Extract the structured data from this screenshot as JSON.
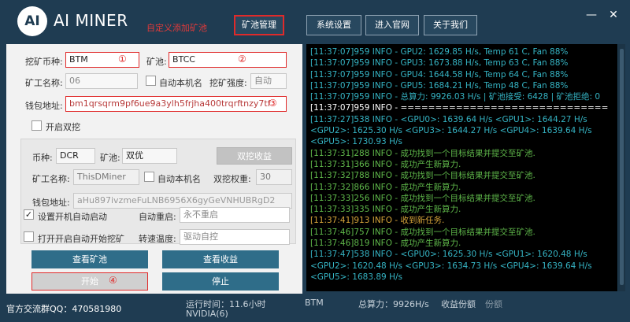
{
  "app": {
    "logo_text": "AI",
    "title": "AI MINER"
  },
  "annotations": {
    "custom_pool": "自定义添加矿池",
    "coin": "①",
    "pool": "②",
    "wallet": "③",
    "start": "④"
  },
  "nav": {
    "pool_manage": "矿池管理",
    "settings": "系统设置",
    "website": "进入官网",
    "about": "关于我们"
  },
  "window": {
    "minimize": "—",
    "close": "✕"
  },
  "form": {
    "coin_label": "挖矿币种:",
    "coin_value": "BTM",
    "pool_label": "矿池:",
    "pool_value": "BTCC",
    "worker_label": "矿工名称:",
    "worker_value": "06",
    "auto_name_label": "自动本机名",
    "intensity_label": "挖矿强度:",
    "intensity_value": "自动",
    "wallet_label": "钱包地址:",
    "wallet_value": "bm1qrsqrm9pf6ue9a3ylh5frjha400trqrftnzy7tf"
  },
  "dual": {
    "enable_label": "开启双挖",
    "coin_label": "币种:",
    "coin_value": "DCR",
    "pool_label": "矿池:",
    "pool_value": "双优",
    "profit_button": "双挖收益",
    "worker_label": "矿工名称:",
    "worker_placeholder": "ThisDMiner",
    "auto_name_label": "自动本机名",
    "weight_label": "双挖权重:",
    "weight_value": "30",
    "wallet_label": "钱包地址:",
    "wallet_placeholder": "aHu897ivzmeFuLNB6956X6gyGeVNHUBRgD2"
  },
  "startup": {
    "autostart_label": "设置开机自动启动",
    "autostart_checked": true,
    "restart_label": "自动重启:",
    "restart_value": "永不重启",
    "open_mine_label": "打开开启自动开始挖矿",
    "temp_label": "转速温度:",
    "temp_value": "驱动自控"
  },
  "actions": {
    "view_pool": "查看矿池",
    "view_profit": "查看收益",
    "start": "开始",
    "stop": "停止"
  },
  "log": [
    {
      "text": "[11:37:07]959 INFO - GPU2: 1629.85 H/s, Temp 61 C, Fan 88%",
      "color": "#35b4c4"
    },
    {
      "text": "[11:37:07]959 INFO - GPU3: 1673.88 H/s, Temp 63 C, Fan 88%",
      "color": "#35b4c4"
    },
    {
      "text": "[11:37:07]959 INFO - GPU4: 1644.58 H/s, Temp 64 C, Fan 88%",
      "color": "#35b4c4"
    },
    {
      "text": "[11:37:07]959 INFO - GPU5: 1684.21 H/s, Temp 48 C, Fan 88%",
      "color": "#35b4c4"
    },
    {
      "text": "[11:37:07]959 INFO - 总算力: 9926.03 H/s | 矿池接受: 6428 | 矿池拒绝: 0",
      "color": "#35b4c4"
    },
    {
      "text": "[11:37:07]959 INFO - ==============================",
      "color": "#ffffff"
    },
    {
      "text": "[11:37:27]538 INFO - <GPU0>: 1639.64 H/s   <GPU1>: 1644.27 H/s",
      "color": "#35b4c4"
    },
    {
      "text": "<GPU2>: 1625.30 H/s   <GPU3>: 1644.27 H/s   <GPU4>: 1639.64 H/s",
      "color": "#35b4c4"
    },
    {
      "text": "<GPU5>: 1730.93 H/s",
      "color": "#35b4c4"
    },
    {
      "text": "[11:37:31]288 INFO - 成功找到一个目标结果并提交至矿池.",
      "color": "#5fb84a"
    },
    {
      "text": "[11:37:31]366 INFO - 成功产生新算力.",
      "color": "#5fb84a"
    },
    {
      "text": "[11:37:32]788 INFO - 成功找到一个目标结果并提交至矿池.",
      "color": "#5fb84a"
    },
    {
      "text": "[11:37:32]866 INFO - 成功产生新算力.",
      "color": "#5fb84a"
    },
    {
      "text": "[11:37:33]256 INFO - 成功找到一个目标结果并提交至矿池.",
      "color": "#5fb84a"
    },
    {
      "text": "[11:37:33]335 INFO - 成功产生新算力.",
      "color": "#5fb84a"
    },
    {
      "text": "[11:37:41]913 INFO - 收到新任务.",
      "color": "#d6a43a"
    },
    {
      "text": "[11:37:46]757 INFO - 成功找到一个目标结果并提交至矿池.",
      "color": "#5fb84a"
    },
    {
      "text": "[11:37:46]819 INFO - 成功产生新算力.",
      "color": "#5fb84a"
    },
    {
      "text": "[11:37:47]538 INFO - <GPU0>: 1625.30 H/s   <GPU1>: 1620.48 H/s",
      "color": "#35b4c4"
    },
    {
      "text": "<GPU2>: 1620.48 H/s   <GPU3>: 1634.73 H/s   <GPU4>: 1639.64 H/s",
      "color": "#35b4c4"
    },
    {
      "text": "<GPU5>: 1683.89 H/s",
      "color": "#35b4c4"
    }
  ],
  "status": {
    "qq_group": "官方交流群QQ：470581980",
    "runtime": "运行时间：11.6小时",
    "gpu": "NVIDIA(6)",
    "coin": "BTM",
    "hashrate": "总算力：9926H/s",
    "profit_label": "收益份额",
    "profit_value": "份额"
  },
  "colors": {
    "title_bg": "#1f3c52",
    "accent_red": "#e02a2a",
    "teal_button": "#2f6d89",
    "log_cyan": "#35b4c4",
    "log_green": "#5fb84a",
    "log_orange": "#d6a43a"
  }
}
